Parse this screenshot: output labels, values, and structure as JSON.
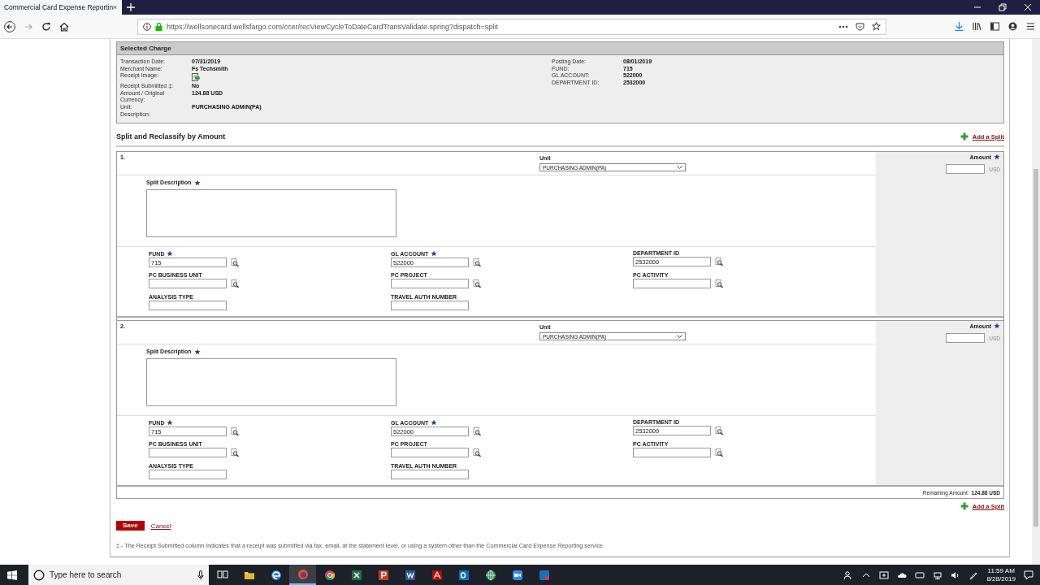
{
  "browser": {
    "tabs": [
      {
        "title": "Commercial Card Expense Reportin",
        "selected": true
      }
    ],
    "url": "https://wellsonecard.wellsfargo.com/ccer/recViewCycleToDateCardTransValidate.spring?dispatch=split"
  },
  "selected_charge": {
    "title": "Selected Charge",
    "left_fields": [
      {
        "label": "Transaction Date:",
        "value": "07/31/2019",
        "kind": "text"
      },
      {
        "label": "Merchant Name:",
        "value": "Fs Techsmith",
        "kind": "text"
      },
      {
        "label": "Receipt Image:",
        "kind": "icon"
      },
      {
        "label": "Receipt Submitted ‡:",
        "value": "No",
        "kind": "text"
      },
      {
        "label": "Amount / Original",
        "value": "124.88 USD",
        "kind": "text"
      },
      {
        "label": "Currency:",
        "kind": "text"
      },
      {
        "label": "Unit:",
        "value": "PURCHASING ADMIN(PA)",
        "kind": "text"
      },
      {
        "label": "Description:",
        "kind": "text"
      }
    ],
    "right_fields": [
      {
        "label": "Posting Date:",
        "value": "08/01/2019"
      },
      {
        "label": "FUND:",
        "value": "715"
      },
      {
        "label": "GL ACCOUNT:",
        "value": "522000"
      },
      {
        "label": "DEPARTMENT ID:",
        "value": "2532000"
      }
    ]
  },
  "split_section": {
    "title": "Split and Reclassify by Amount",
    "add_split": "Add a Split",
    "splits": [
      {
        "number": "1.",
        "unit_label": "Unit",
        "unit_value": "PURCHASING ADMIN(PA)",
        "amount_label": "Amount",
        "currency": "USD",
        "description_label": "Split Description",
        "fields": [
          {
            "label": "FUND",
            "value": "715",
            "required": true,
            "lookup": true
          },
          {
            "label": "GL ACCOUNT",
            "value": "522000",
            "required": true,
            "lookup": true
          },
          {
            "label": "DEPARTMENT ID",
            "value": "2532000",
            "required": false,
            "lookup": true
          },
          {
            "label": "PC BUSINESS UNIT",
            "required": false,
            "lookup": true
          },
          {
            "label": "PC PROJECT",
            "required": false,
            "lookup": true
          },
          {
            "label": "PC ACTIVITY",
            "required": false,
            "lookup": true
          },
          {
            "label": "ANALYSIS TYPE",
            "required": false,
            "lookup": false
          },
          {
            "label": "TRAVEL AUTH NUMBER",
            "required": false,
            "lookup": false
          }
        ]
      },
      {
        "number": "2.",
        "unit_label": "Unit",
        "unit_value": "PURCHASING ADMIN(PA)",
        "amount_label": "Amount",
        "currency": "USD",
        "description_label": "Split Description",
        "fields": [
          {
            "label": "FUND",
            "value": "715",
            "required": true,
            "lookup": true
          },
          {
            "label": "GL ACCOUNT",
            "value": "522000",
            "required": true,
            "lookup": true
          },
          {
            "label": "DEPARTMENT ID",
            "value": "2532000",
            "required": false,
            "lookup": true
          },
          {
            "label": "PC BUSINESS UNIT",
            "required": false,
            "lookup": true
          },
          {
            "label": "PC PROJECT",
            "required": false,
            "lookup": true
          },
          {
            "label": "PC ACTIVITY",
            "required": false,
            "lookup": true
          },
          {
            "label": "ANALYSIS TYPE",
            "required": false,
            "lookup": false
          },
          {
            "label": "TRAVEL AUTH NUMBER",
            "required": false,
            "lookup": false
          }
        ]
      }
    ],
    "remaining_label": "Remaining Amount:",
    "remaining_value": "124.88 USD",
    "add_split_bottom": "Add a Split"
  },
  "buttons": {
    "save": "Save",
    "cancel": "Cancel"
  },
  "footnote": "‡ - The Receipt Submitted column indicates that a receipt was submitted via fax, email, at the statement level, or using a system other than the Commercial Card Expense Reporting service.",
  "taskbar": {
    "search_placeholder": "Type here to search",
    "apps": [
      {
        "kind": "taskview",
        "selected": false
      },
      {
        "kind": "folder",
        "selected": false
      },
      {
        "kind": "edge",
        "selected": false
      },
      {
        "kind": "firefox",
        "selected": true
      },
      {
        "kind": "chrome",
        "selected": false
      },
      {
        "kind": "excel",
        "selected": false
      },
      {
        "kind": "powerpoint",
        "selected": false
      },
      {
        "kind": "word",
        "selected": false
      },
      {
        "kind": "acrobat",
        "selected": false
      },
      {
        "kind": "outlook",
        "selected": false
      },
      {
        "kind": "globe",
        "selected": false
      },
      {
        "kind": "zoom",
        "selected": false
      },
      {
        "kind": "snagit",
        "selected": false
      }
    ],
    "time": "11:59 AM",
    "date": "8/28/2019"
  }
}
